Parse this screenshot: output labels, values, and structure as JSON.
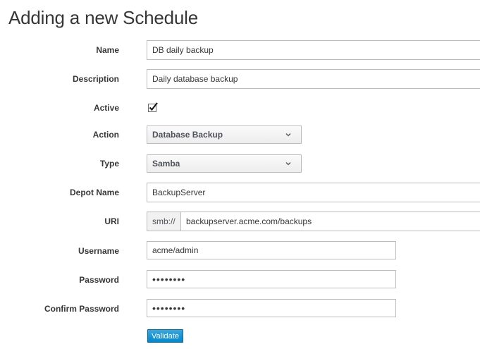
{
  "page": {
    "title": "Adding a new Schedule"
  },
  "form": {
    "name": {
      "label": "Name",
      "value": "DB daily backup"
    },
    "description": {
      "label": "Description",
      "value": "Daily database backup"
    },
    "active": {
      "label": "Active",
      "checked": true
    },
    "action": {
      "label": "Action",
      "selected": "Database Backup"
    },
    "type": {
      "label": "Type",
      "selected": "Samba"
    },
    "depot_name": {
      "label": "Depot Name",
      "value": "BackupServer"
    },
    "uri": {
      "label": "URI",
      "prefix": "smb://",
      "value": "backupserver.acme.com/backups"
    },
    "username": {
      "label": "Username",
      "value": "acme/admin"
    },
    "password": {
      "label": "Password",
      "value": "••••••••"
    },
    "confirm_password": {
      "label": "Confirm Password",
      "value": "••••••••"
    }
  },
  "buttons": {
    "validate_label": "Validate"
  },
  "icons": {
    "checkbox": "checkmark-icon",
    "dropdown": "chevron-down-icon"
  },
  "colors": {
    "primary_button": "#0088ce",
    "text": "#363636",
    "border": "#bbbbbb"
  }
}
